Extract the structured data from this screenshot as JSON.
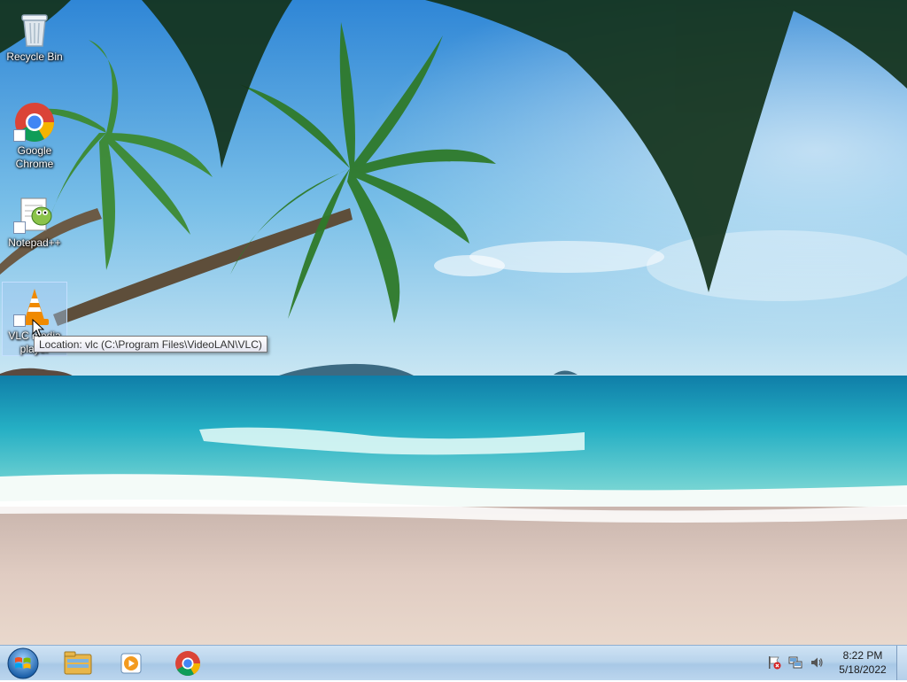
{
  "desktop": {
    "icons": [
      {
        "label": "Recycle Bin"
      },
      {
        "label": "Google Chrome"
      },
      {
        "label": "Notepad++"
      },
      {
        "label": "VLC media player"
      }
    ],
    "tooltip": "Location: vlc (C:\\Program Files\\VideoLAN\\VLC)"
  },
  "taskbar": {
    "pinned": [
      {
        "icon": "file-explorer-icon"
      },
      {
        "icon": "media-player-icon"
      },
      {
        "icon": "chrome-icon"
      }
    ],
    "clock": {
      "time": "8:22 PM",
      "date": "5/18/2022"
    }
  },
  "colors": {
    "sky": "#4a9fdc",
    "sea": "#2bb5c6",
    "sand": "#d9c3ba",
    "taskbar": "#b9d4ec"
  }
}
